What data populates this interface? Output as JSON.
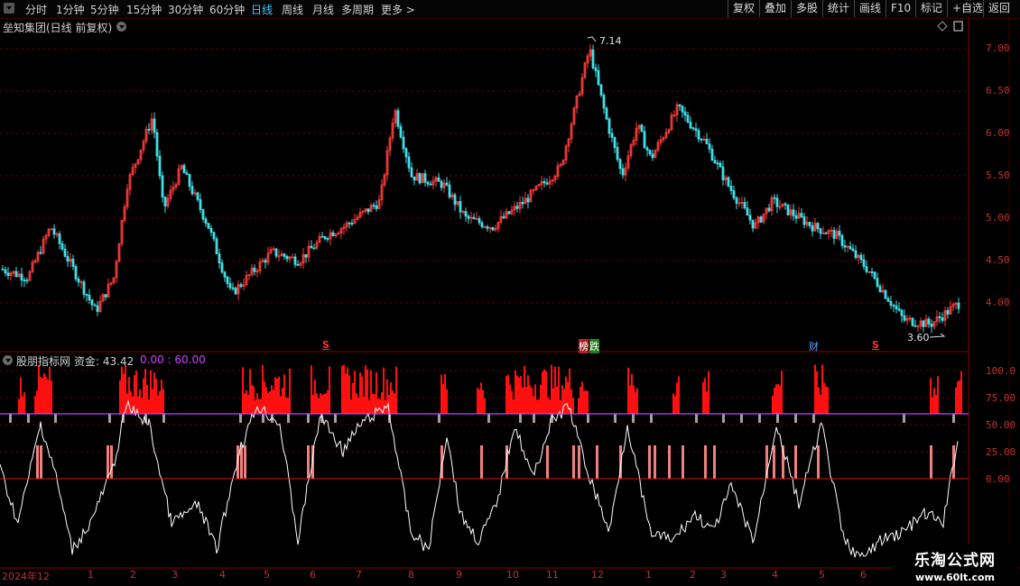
{
  "toolbar": {
    "periods": [
      "分时",
      "1分钟",
      "5分钟",
      "15分钟",
      "30分钟",
      "60分钟",
      "日线",
      "周线",
      "月线",
      "多周期",
      "更多 >"
    ],
    "active_period": "日线",
    "buttons": [
      "复权",
      "叠加",
      "多股",
      "统计",
      "画线",
      "F10",
      "标记",
      "+自选",
      "返回"
    ]
  },
  "stock": {
    "title": "垒知集团(日线 前复权)",
    "high_label": "7.14",
    "low_label": "3.60",
    "markers": [
      "S",
      "榜",
      "跌",
      "财",
      "S"
    ]
  },
  "price_axis": {
    "labels": [
      "7.00",
      "6.50",
      "6.00",
      "5.50",
      "5.00",
      "4.50",
      "4.00"
    ]
  },
  "indicator": {
    "title": "股朋指标网",
    "value_label": "资金: 43.42",
    "range_label": "0.00 : 60.00",
    "axis_labels": [
      "100.0",
      "75.00",
      "50.00",
      "25.00",
      "0.00"
    ]
  },
  "date_axis": {
    "labels": [
      "2024年12",
      "1",
      "2",
      "3",
      "4",
      "5",
      "6",
      "7",
      "8",
      "9",
      "10",
      "11",
      "12",
      "1",
      "2",
      "3",
      "4",
      "5",
      "6"
    ]
  },
  "watermark": {
    "line1": "乐淘公式网",
    "line2": "www.60lt.com"
  },
  "colors": {
    "up": "#ff3c3c",
    "down": "#40e0e8",
    "grid": "#7a0000",
    "magenta": "#c040ff",
    "accent": "#40c8ff"
  }
}
